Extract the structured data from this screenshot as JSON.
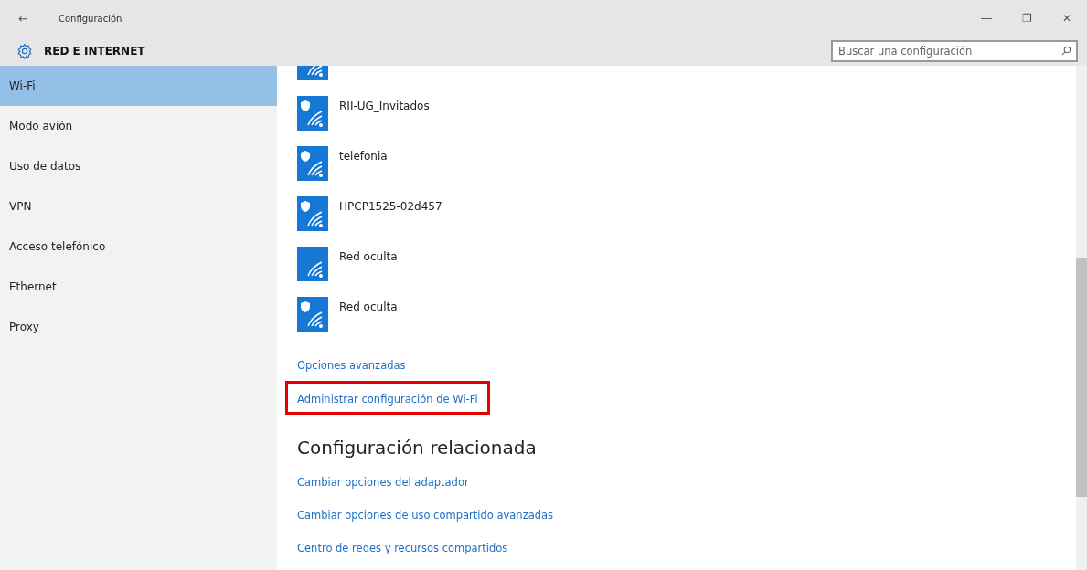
{
  "window": {
    "title": "Configuración",
    "back": "←",
    "controls": [
      "—",
      "❐",
      "✕"
    ]
  },
  "header": {
    "title": "RED E INTERNET",
    "search": {
      "placeholder": "Buscar una configuración"
    }
  },
  "sidebar": {
    "items": [
      {
        "label": "Wi-Fi",
        "selected": true
      },
      {
        "label": "Modo avión",
        "selected": false
      },
      {
        "label": "Uso de datos",
        "selected": false
      },
      {
        "label": "VPN",
        "selected": false
      },
      {
        "label": "Acceso telefónico",
        "selected": false
      },
      {
        "label": "Ethernet",
        "selected": false
      },
      {
        "label": "Proxy",
        "selected": false
      }
    ]
  },
  "networks": [
    {
      "kind": "cut"
    },
    {
      "name": "RII-UG_Invitados",
      "secured": true
    },
    {
      "name": "telefonia",
      "secured": true
    },
    {
      "name": "HPCP1525-02d457",
      "secured": true
    },
    {
      "name": "Red oculta",
      "secured": false
    },
    {
      "name": "Red oculta",
      "secured": true
    }
  ],
  "links": [
    {
      "label": "Opciones avanzadas",
      "highlighted": false
    },
    {
      "label": "Administrar configuración de Wi-Fi",
      "highlighted": true
    }
  ],
  "related": {
    "title": "Configuración relacionada",
    "links": [
      "Cambiar opciones del adaptador",
      "Cambiar opciones de uso compartido avanzadas",
      "Centro de redes y recursos compartidos"
    ]
  }
}
